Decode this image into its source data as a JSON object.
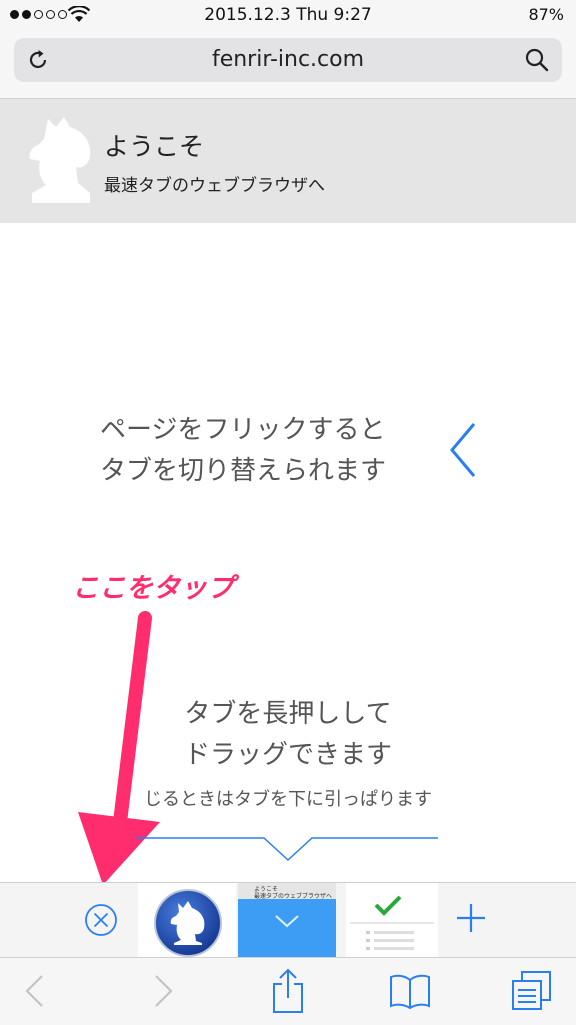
{
  "status_bar": {
    "time": "2015.12.3 Thu 9:27",
    "battery": "87%"
  },
  "address_bar": {
    "url": "fenrir-inc.com"
  },
  "banner": {
    "title": "ようこそ",
    "subtitle": "最速タブのウェブブラウザへ"
  },
  "content": {
    "flick_line1": "ページをフリックすると",
    "flick_line2": "タブを切り替えられます",
    "annotation": "ここをタップ",
    "press_line1": "タブを長押しして",
    "press_line2": "ドラッグできます",
    "close_hint": "じるときはタブを下に引っぱります"
  },
  "tab_bar": {
    "current_tab_preview_line1": "ようこそ",
    "current_tab_preview_line2": "最速タブのウェブブラウザへ"
  },
  "colors": {
    "accent": "#2a7ff0",
    "annotation": "#ff2d6e",
    "check": "#2aa83a"
  }
}
